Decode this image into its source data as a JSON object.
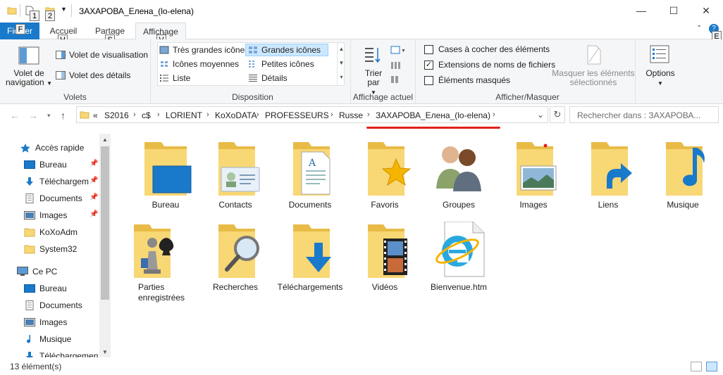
{
  "window": {
    "title": "ЗАХАРОВА_Елена_(lo-elena)",
    "qat_keytips": [
      "1",
      "2"
    ],
    "controls": {
      "minimize": "—",
      "maximize": "☐",
      "close": "✕"
    }
  },
  "tabs": {
    "file": "Fichier",
    "file_keytip": "F",
    "items": [
      {
        "label": "Accueil",
        "keytip": "H"
      },
      {
        "label": "Partage",
        "keytip": "S"
      },
      {
        "label": "Affichage",
        "keytip": "V"
      }
    ],
    "help_keytip": "E"
  },
  "ribbon": {
    "volets": {
      "group_label": "Volets",
      "nav_pane": "Volet de navigation",
      "preview_pane": "Volet de visualisation",
      "details_pane": "Volet des détails"
    },
    "disposition": {
      "group_label": "Disposition",
      "options": [
        "Très grandes icônes",
        "Grandes icônes",
        "Icônes moyennes",
        "Petites icônes",
        "Liste",
        "Détails"
      ],
      "selected": "Grandes icônes"
    },
    "affichage_actuel": {
      "group_label": "Affichage actuel",
      "sort_by": "Trier par"
    },
    "afficher_masquer": {
      "group_label": "Afficher/Masquer",
      "checkboxes": [
        {
          "label": "Cases à cocher des éléments",
          "checked": false
        },
        {
          "label": "Extensions de noms de fichiers",
          "checked": true
        },
        {
          "label": "Éléments masqués",
          "checked": false
        }
      ],
      "hide_selected": "Masquer les éléments sélectionnés"
    },
    "options": {
      "label": "Options"
    }
  },
  "address": {
    "prefix": "«",
    "crumbs": [
      "S2016",
      "c$",
      "LORIENT",
      "KoXoDATA",
      "PROFESSEURS",
      "Russe",
      "ЗАХАРОВА_Елена_(lo-elena)"
    ],
    "search_placeholder": "Rechercher dans : ЗАХАРОВА..."
  },
  "nav_pane": {
    "items": [
      {
        "label": "Accès rapide",
        "icon": "star-icon",
        "level": 0,
        "pinned": false
      },
      {
        "label": "Bureau",
        "icon": "desktop-icon",
        "level": 1,
        "pinned": true
      },
      {
        "label": "Téléchargements",
        "icon": "download-icon",
        "level": 1,
        "pinned": true
      },
      {
        "label": "Documents",
        "icon": "documents-icon",
        "level": 1,
        "pinned": true
      },
      {
        "label": "Images",
        "icon": "images-icon",
        "level": 1,
        "pinned": true
      },
      {
        "label": "KoXoAdm",
        "icon": "folder-icon",
        "level": 1,
        "pinned": false
      },
      {
        "label": "System32",
        "icon": "folder-icon",
        "level": 1,
        "pinned": false
      },
      {
        "label": "Ce PC",
        "icon": "pc-icon",
        "level": 0,
        "pinned": false
      },
      {
        "label": "Bureau",
        "icon": "desktop-icon",
        "level": 1,
        "pinned": false
      },
      {
        "label": "Documents",
        "icon": "documents-icon",
        "level": 1,
        "pinned": false
      },
      {
        "label": "Images",
        "icon": "images-icon",
        "level": 1,
        "pinned": false
      },
      {
        "label": "Musique",
        "icon": "music-icon",
        "level": 1,
        "pinned": false
      },
      {
        "label": "Téléchargements",
        "icon": "download-icon",
        "level": 1,
        "pinned": false
      }
    ]
  },
  "files": [
    {
      "label": "Bureau",
      "icon": "desktop-folder-icon"
    },
    {
      "label": "Contacts",
      "icon": "contacts-folder-icon"
    },
    {
      "label": "Documents",
      "icon": "documents-folder-icon"
    },
    {
      "label": "Favoris",
      "icon": "favorites-folder-icon"
    },
    {
      "label": "Groupes",
      "icon": "groups-icon"
    },
    {
      "label": "Images",
      "icon": "images-folder-icon"
    },
    {
      "label": "Liens",
      "icon": "links-folder-icon"
    },
    {
      "label": "Musique",
      "icon": "music-folder-icon"
    },
    {
      "label": "Parties enregistrées",
      "icon": "saved-games-folder-icon"
    },
    {
      "label": "Recherches",
      "icon": "searches-folder-icon"
    },
    {
      "label": "Téléchargements",
      "icon": "downloads-folder-icon"
    },
    {
      "label": "Vidéos",
      "icon": "videos-folder-icon"
    },
    {
      "label": "Bienvenue.htm",
      "icon": "ie-html-file-icon"
    }
  ],
  "status": {
    "count": "13 élément(s)"
  },
  "colors": {
    "accent": "#1979ca",
    "folder": "#f8d775",
    "annotation": "#e3201b"
  }
}
